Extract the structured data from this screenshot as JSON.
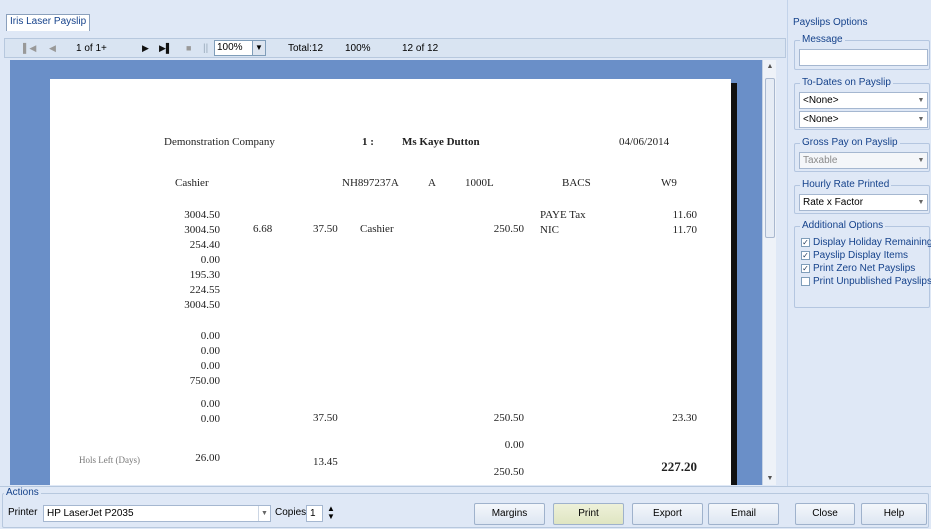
{
  "tab": {
    "label": "Iris Laser Payslip"
  },
  "toolbar": {
    "page_info": "1 of 1+",
    "zoom_select": "100%",
    "total": "Total:12",
    "zoom_pct": "100%",
    "count": "12 of 12"
  },
  "payslip": {
    "company": "Demonstration Company",
    "employee_no": "1 :",
    "employee_name": "Ms Kaye Dutton",
    "date": "04/06/2014",
    "department": "Cashier",
    "ni_number": "NH897237A",
    "ni_letter": "A",
    "tax_code": "1000L",
    "pay_method": "BACS",
    "period": "W9",
    "col1_top": [
      "3004.50",
      "3004.50",
      "254.40",
      "0.00",
      "195.30",
      "224.55",
      "3004.50"
    ],
    "rate": "6.68",
    "hours": "37.50",
    "desc": "Cashier",
    "amount": "250.50",
    "ded_labels": [
      "PAYE Tax",
      "NIC"
    ],
    "ded_values": [
      "11.60",
      "11.70"
    ],
    "col1_mid": [
      "0.00",
      "0.00",
      "0.00",
      "750.00"
    ],
    "col1_bottom": [
      "0.00",
      "0.00"
    ],
    "total_hours": "37.50",
    "total_amount": "250.50",
    "total_deductions": "23.30",
    "extra_amount": "0.00",
    "hols_label": "Hols Left (Days)",
    "hols_value": "26.00",
    "hols_hours": "13.45",
    "gross_pay": "250.50",
    "net_pay": "227.20"
  },
  "options": {
    "title": "Payslips Options",
    "message_group": "Message",
    "message_value": "",
    "todates_group": "To-Dates on Payslip",
    "todates_1": "<None>",
    "todates_2": "<None>",
    "gross_group": "Gross Pay on Payslip",
    "gross_value": "Taxable",
    "hourly_group": "Hourly Rate Printed",
    "hourly_value": "Rate x Factor",
    "additional_group": "Additional Options",
    "checks": [
      {
        "label": "Display Holiday Remaining",
        "checked": true
      },
      {
        "label": "Payslip Display Items",
        "checked": true
      },
      {
        "label": "Print Zero Net Payslips",
        "checked": true
      },
      {
        "label": "Print Unpublished Payslips",
        "checked": false
      }
    ]
  },
  "actions": {
    "title": "Actions",
    "printer_label": "Printer",
    "printer_value": "HP LaserJet P2035",
    "copies_label": "Copies",
    "copies_value": "1",
    "margins": "Margins",
    "print": "Print",
    "export": "Export",
    "email": "Email",
    "close": "Close",
    "help": "Help"
  }
}
